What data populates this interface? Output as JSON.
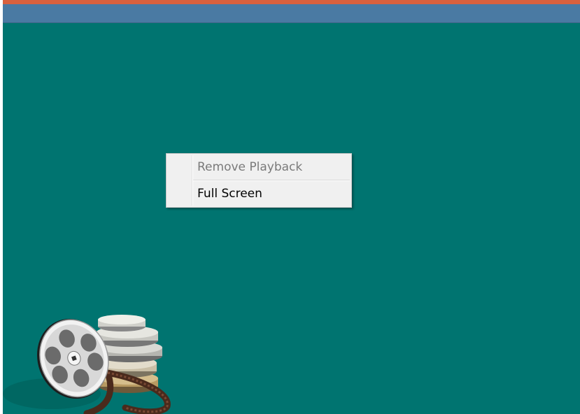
{
  "window": {
    "background_color": "#007470",
    "top_bar_color": "#4a7aa3",
    "accent_color": "#d9613e"
  },
  "context_menu": {
    "items": [
      {
        "label": "Remove Playback",
        "enabled": false
      },
      {
        "label": "Full Screen",
        "enabled": true
      }
    ]
  },
  "logo": {
    "icon": "film-reel-icon"
  }
}
